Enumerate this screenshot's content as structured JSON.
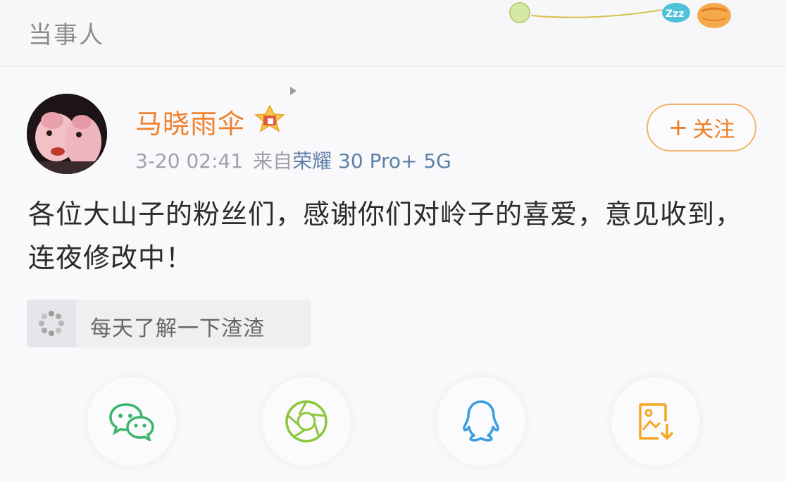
{
  "header": {
    "title": "当事人",
    "decoration_text": "Zzz"
  },
  "post": {
    "username": "马晓雨伞",
    "timestamp": "3-20 02:41",
    "source_prefix": "来自",
    "device": "荣耀 30 Pro+ 5G",
    "follow_label": "关注",
    "follow_plus": "+",
    "text": "各位大山子的粉丝们，感谢你们对岭子的喜爱，意见收到，连夜修改中！",
    "topic": "每天了解一下渣渣"
  },
  "share": [
    {
      "name": "wechat",
      "icon": "wechat-icon",
      "color": "#3bb56a"
    },
    {
      "name": "moments",
      "icon": "moments-icon",
      "color": "#8cc63e"
    },
    {
      "name": "qq",
      "icon": "qq-icon",
      "color": "#3a9ee0"
    },
    {
      "name": "save-image",
      "icon": "save-image-icon",
      "color": "#f5a623"
    }
  ],
  "colors": {
    "username": "#f0802c",
    "device": "#5d7fa6",
    "follow": "#ee7d22"
  }
}
